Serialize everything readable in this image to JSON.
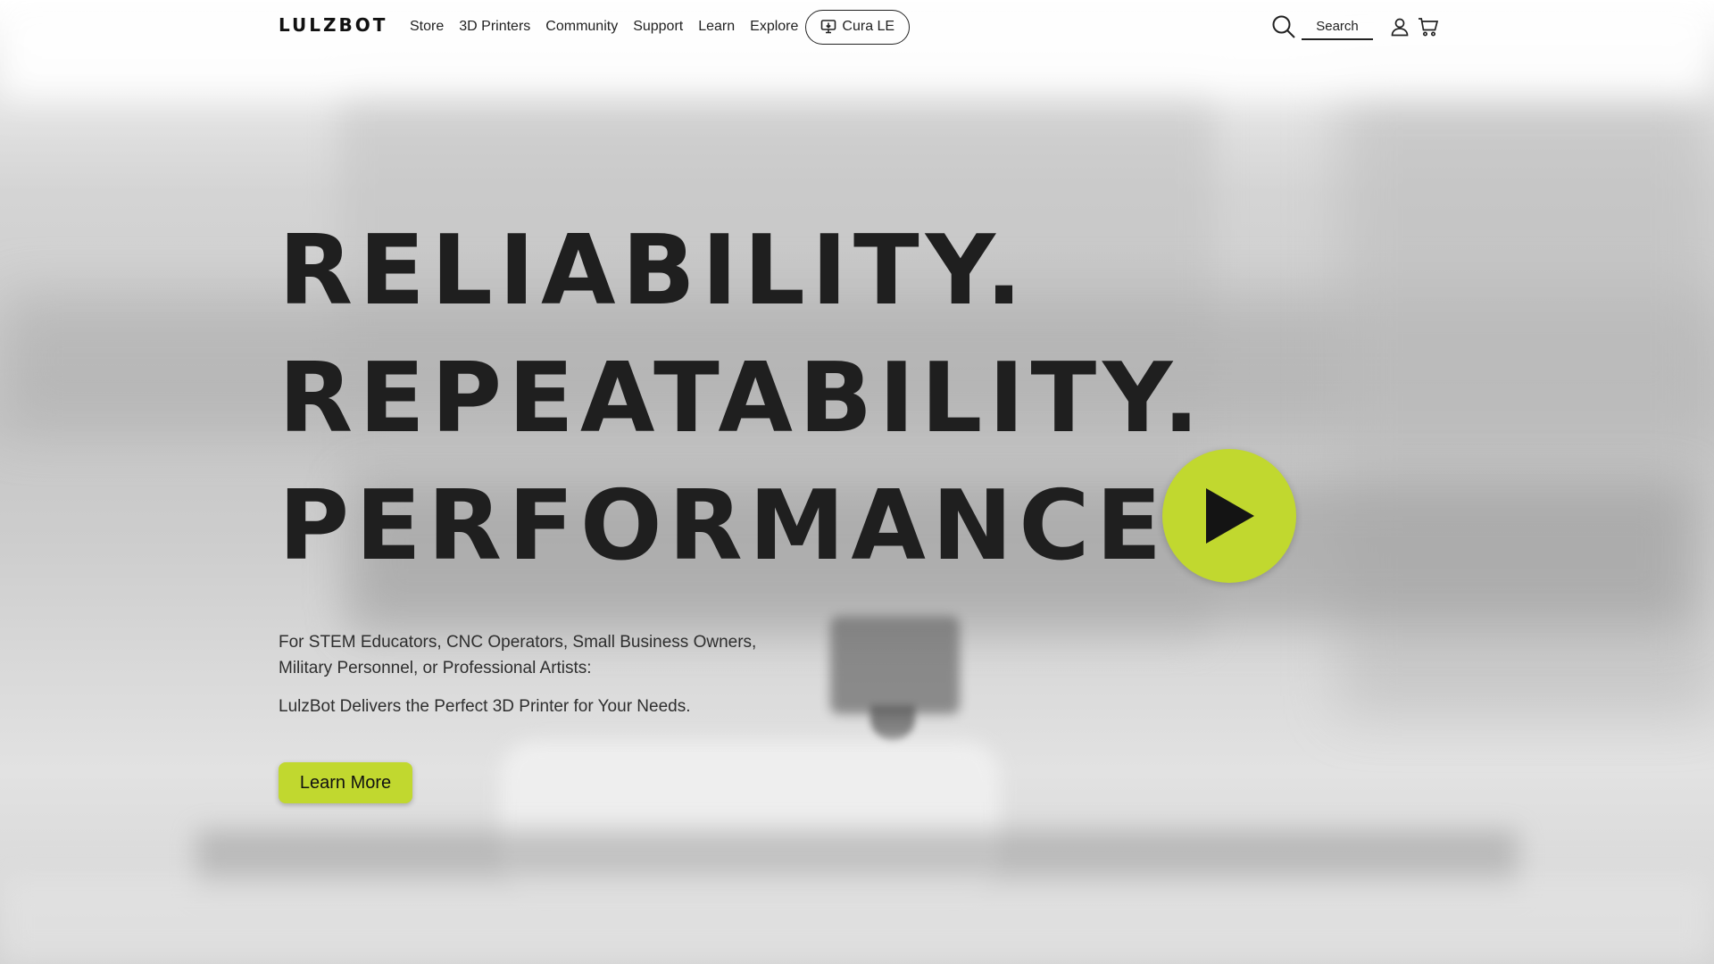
{
  "brand": {
    "logo_text": "LULZBOT",
    "accent_color": "#c1d82f"
  },
  "nav": {
    "items": [
      "Store",
      "3D Printers",
      "Community",
      "Support",
      "Learn",
      "Explore"
    ],
    "cura_label": "Cura LE"
  },
  "header": {
    "search_label": "Search",
    "icons": [
      "search-icon",
      "user-icon",
      "cart-icon"
    ]
  },
  "hero": {
    "headline": [
      "RELIABILITY.",
      "REPEATABILITY.",
      "PERFORMANCE."
    ],
    "subtitle": "For STEM Educators, CNC Operators, Small Business Owners, Military Personnel, or Professional Artists:",
    "subtitle2": "LulzBot Delivers the Perfect 3D Printer for Your Needs.",
    "cta_label": "Learn More",
    "play_icon": "play-icon"
  }
}
